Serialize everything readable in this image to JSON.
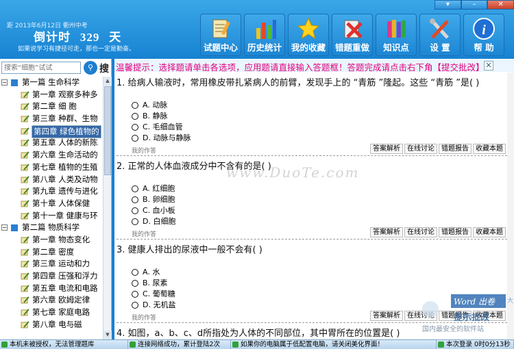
{
  "window_controls": [
    "▾",
    "–",
    "✕"
  ],
  "header": {
    "date_line": "距  2013年6月12日  衢州中考",
    "countdown_label": "倒计时",
    "countdown_value": "329",
    "countdown_unit": "天",
    "slogan": "如果说学习有捷径可走，那也一定是勤奋。"
  },
  "nav": [
    {
      "label": "试题中心",
      "icon": "notepad-pencil-icon"
    },
    {
      "label": "历史统计",
      "icon": "bar-chart-icon"
    },
    {
      "label": "我的收藏",
      "icon": "star-icon"
    },
    {
      "label": "错题重做",
      "icon": "wrong-cross-icon"
    },
    {
      "label": "知识点",
      "icon": "books-icon"
    },
    {
      "label": "设  置",
      "icon": "tools-icon"
    },
    {
      "label": "帮  助",
      "icon": "info-icon"
    }
  ],
  "search": {
    "placeholder": "搜索“细胞”试试",
    "button_label": "搜"
  },
  "tree": [
    {
      "type": "part",
      "label": "第一篇   生命科学"
    },
    {
      "type": "chapter",
      "label": "第一章   观察多种多"
    },
    {
      "type": "chapter",
      "label": "第二章   细   胞"
    },
    {
      "type": "chapter",
      "label": "第三章   种群、生物"
    },
    {
      "type": "chapter",
      "label": "第四章   绿色植物的",
      "selected": true
    },
    {
      "type": "chapter",
      "label": "第五章   人体的新陈"
    },
    {
      "type": "chapter",
      "label": "第六章   生命活动的"
    },
    {
      "type": "chapter",
      "label": "第七章   植物的生殖"
    },
    {
      "type": "chapter",
      "label": "第八章   人类及动物"
    },
    {
      "type": "chapter",
      "label": "第九章   遗传与进化"
    },
    {
      "type": "chapter",
      "label": "第十章   人体保健"
    },
    {
      "type": "chapter",
      "label": "第十一章   健康与环"
    },
    {
      "type": "part",
      "label": "第二篇   物质科学"
    },
    {
      "type": "chapter",
      "label": "第一章   物态变化"
    },
    {
      "type": "chapter",
      "label": "第二章   密度"
    },
    {
      "type": "chapter",
      "label": "第三章   运动和力"
    },
    {
      "type": "chapter",
      "label": "第四章   压强和浮力"
    },
    {
      "type": "chapter",
      "label": "第五章   电流和电路"
    },
    {
      "type": "chapter",
      "label": "第六章   欧姆定律"
    },
    {
      "type": "chapter",
      "label": "第七章   家庭电路"
    },
    {
      "type": "chapter",
      "label": "第八章   电与磁"
    }
  ],
  "notice": "温馨提示：选择题请单击各选项，应用题请直接输入答题框！答题完成请点击右下角【提交批改】",
  "questions": [
    {
      "title": "1.  给病人输液时，常用橡皮带扎紧病人的前臂，发现手上的 “青筋 ”隆起。这些 “青筋 ”是(      )",
      "options": [
        "A.  动脉",
        "B.  静脉",
        "C.  毛细血管",
        "D.  动脉与静脉"
      ],
      "my_answer_label": "我的作答",
      "actions": [
        "答案解析",
        "在线讨论",
        "错题报告",
        "收藏本题"
      ]
    },
    {
      "title": "2.  正常的人体血液成分中不含有的是(     )",
      "options": [
        "A.  红细胞",
        "B.  卵细胞",
        "C.  血小板",
        "D.  白细胞"
      ],
      "my_answer_label": "我的作答",
      "actions": [
        "答案解析",
        "在线讨论",
        "错题报告",
        "收藏本题"
      ]
    },
    {
      "title": "3.  健康人排出的尿液中一般不会有(      )",
      "options": [
        "A.  水",
        "B.  尿素",
        "C.  葡萄糖",
        "D.  无机盐"
      ],
      "my_answer_label": "我的作答",
      "actions": [
        "答案解析",
        "在线讨论",
        "错题报告",
        "收藏本题"
      ]
    },
    {
      "title": "4.  如图，a、b、c、d所指处为人体的不同部位，其中胃所在的位置是(      )",
      "options": [],
      "my_answer_label": "",
      "actions": []
    }
  ],
  "watermark": "www.DuoTe.com",
  "logo_watermark": {
    "line1": "Word 出卷",
    "line2": "提示批改",
    "footer": "国内最安全的软件站",
    "side": "大全"
  },
  "status": [
    "本机未被授权，无法管理题库",
    "连接网络成功，累计登陆2次",
    "如果你的电脑属于低配置电脑，请关闭美化界面！",
    "本次登录  0时0分13秒"
  ]
}
